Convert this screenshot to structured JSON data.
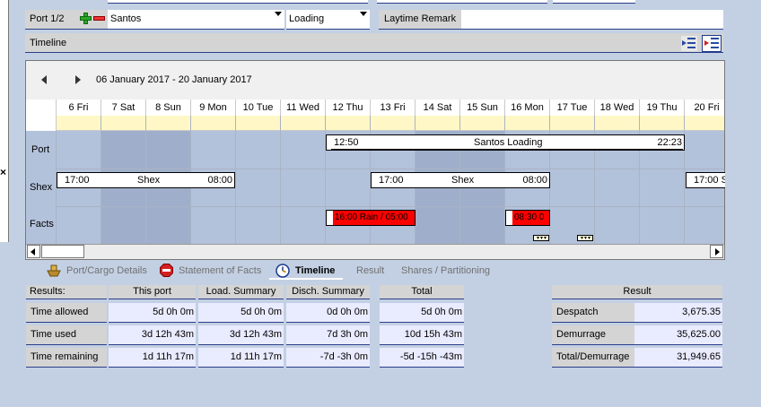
{
  "header": {
    "port_label": "Port 1/2",
    "port_name": "Santos",
    "operation": "Loading",
    "laytime_remark_label": "Laytime Remark",
    "laytime_remark_value": ""
  },
  "timeline_section": {
    "title": "Timeline",
    "date_range": "06 January 2017 - 20 January 2017",
    "days": [
      "6 Fri",
      "7 Sat",
      "8 Sun",
      "9 Mon",
      "10 Tue",
      "11 Wed",
      "12 Thu",
      "13 Fri",
      "14 Sat",
      "15 Sun",
      "16 Mon",
      "17 Tue",
      "18 Wed",
      "19 Thu",
      "20 Fri"
    ],
    "row_labels": {
      "port": "Port",
      "shex": "Shex",
      "facts": "Facts"
    },
    "port_bar": {
      "start": "12:50",
      "label": "Santos Loading",
      "end": "22:23"
    },
    "shex_bars": [
      {
        "start": "17:00",
        "label": "Shex",
        "end": "08:00"
      },
      {
        "start": "17:00",
        "label": "Shex",
        "end": "08:00"
      },
      {
        "start": "17:00 S",
        "label": "",
        "end": ""
      }
    ],
    "facts": [
      {
        "text": "16:00 Rain / 05:00"
      },
      {
        "text": "08:30 0"
      }
    ]
  },
  "tabs": {
    "port_cargo": "Port/Cargo Details",
    "sof": "Statement of Facts",
    "timeline": "Timeline",
    "result": "Result",
    "shares": "Shares / Partitioning"
  },
  "results": {
    "label_header": "Results:",
    "columns": [
      "This port",
      "Load. Summary",
      "Disch. Summary"
    ],
    "total_header": "Total",
    "rows": [
      {
        "label": "Time allowed",
        "values": [
          "5d 0h 0m",
          "5d 0h 0m",
          "0d 0h 0m"
        ],
        "total": "5d 0h 0m"
      },
      {
        "label": "Time used",
        "values": [
          "3d 12h 43m",
          "3d 12h 43m",
          "7d 3h 0m"
        ],
        "total": "10d 15h 43m"
      },
      {
        "label": "Time remaining",
        "values": [
          "1d 11h 17m",
          "1d 11h 17m",
          "-7d -3h 0m"
        ],
        "total": "-5d -15h -43m"
      }
    ]
  },
  "result_box": {
    "header": "Result",
    "rows": [
      {
        "label": "Despatch",
        "value": "3,675.35"
      },
      {
        "label": "Demurrage",
        "value": "35,625.00"
      },
      {
        "label": "Total/Demurrage",
        "value": "31,949.65"
      }
    ]
  },
  "colors": {
    "accent_border": "#2a3e8a",
    "fact_red": "#ff0000",
    "weekend": "#9fafcb",
    "weekday": "#b3c2db"
  }
}
